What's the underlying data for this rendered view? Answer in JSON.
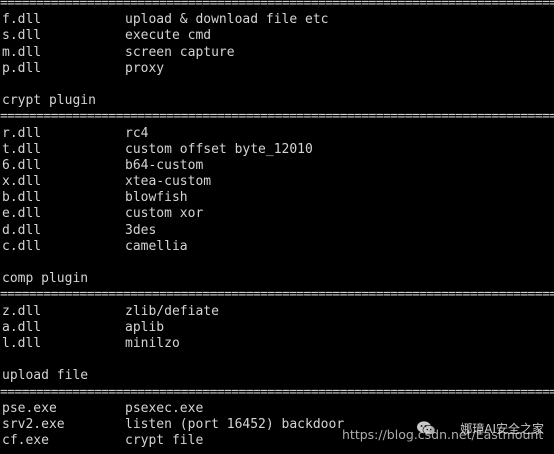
{
  "separator": "=====================================================================================================",
  "sections": [
    {
      "header": "",
      "rows": [
        {
          "name": "f.dll",
          "desc": "upload & download file etc"
        },
        {
          "name": "s.dll",
          "desc": "execute cmd"
        },
        {
          "name": "m.dll",
          "desc": "screen capture"
        },
        {
          "name": "p.dll",
          "desc": "proxy"
        }
      ]
    },
    {
      "header": "crypt plugin",
      "rows": [
        {
          "name": "r.dll",
          "desc": "rc4"
        },
        {
          "name": "t.dll",
          "desc": "custom offset byte_12010"
        },
        {
          "name": "6.dll",
          "desc": "b64-custom"
        },
        {
          "name": "x.dll",
          "desc": "xtea-custom"
        },
        {
          "name": "b.dll",
          "desc": "blowfish"
        },
        {
          "name": "e.dll",
          "desc": "custom xor"
        },
        {
          "name": "d.dll",
          "desc": "3des"
        },
        {
          "name": "c.dll",
          "desc": "camellia"
        }
      ]
    },
    {
      "header": "comp plugin",
      "rows": [
        {
          "name": "z.dll",
          "desc": "zlib/defiate"
        },
        {
          "name": "a.dll",
          "desc": "aplib"
        },
        {
          "name": "l.dll",
          "desc": "minilzo"
        }
      ]
    },
    {
      "header": "upload file",
      "rows": [
        {
          "name": "pse.exe",
          "desc": "psexec.exe"
        },
        {
          "name": "srv2.exe",
          "desc": "listen (port 16452) backdoor"
        },
        {
          "name": "cf.exe",
          "desc": "crypt file"
        }
      ]
    }
  ],
  "watermark": {
    "url": "https://blog.csdn.net/Eastmount",
    "brand": "娜璋AI安全之家",
    "icon": "wechat-icon"
  },
  "colors": {
    "background": "#000000",
    "text": "#d4d4d4"
  }
}
